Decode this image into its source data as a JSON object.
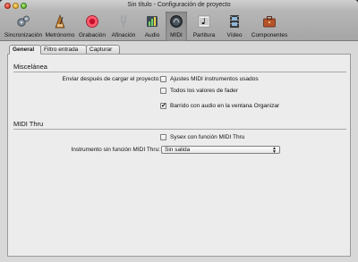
{
  "window": {
    "title": "Sin título - Configuración de proyecto"
  },
  "toolbar": {
    "items": [
      {
        "label": "Sincronización",
        "icon": "gear-icon"
      },
      {
        "label": "Metrónomo",
        "icon": "metronome-icon"
      },
      {
        "label": "Grabación",
        "icon": "record-icon"
      },
      {
        "label": "Afinación",
        "icon": "tuning-fork-icon"
      },
      {
        "label": "Audio",
        "icon": "audio-meter-icon"
      },
      {
        "label": "MIDI",
        "icon": "midi-icon"
      },
      {
        "label": "Partitura",
        "icon": "score-icon"
      },
      {
        "label": "Vídeo",
        "icon": "video-icon"
      },
      {
        "label": "Componentes",
        "icon": "briefcase-icon"
      }
    ],
    "selected": "MIDI"
  },
  "tabs": [
    {
      "label": "General"
    },
    {
      "label": "Filtro entrada"
    },
    {
      "label": "Capturar"
    }
  ],
  "miscelanea": {
    "heading": "Miscelánea",
    "row_label": "Enviar después de cargar el proyecto:",
    "options": [
      {
        "label": "Ajustes MIDI instrumentos usados",
        "checked": false
      },
      {
        "label": "Todos los valores de fader",
        "checked": false
      }
    ],
    "scrub": {
      "label": "Barrido con audio en la ventana Organizar",
      "checked": true
    }
  },
  "midi_thru": {
    "heading": "MIDI Thru",
    "sysex": {
      "label": "Sysex con función MIDI Thru",
      "checked": false
    },
    "instrument_label": "Instrumento sin función MIDI Thru:",
    "instrument_value": "Sin salida"
  }
}
